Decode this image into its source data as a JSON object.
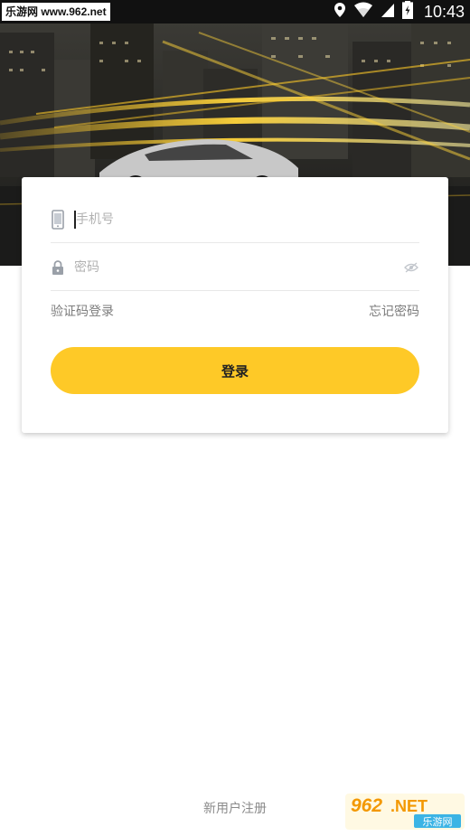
{
  "statusbar": {
    "watermark": "乐游网 www.962.net",
    "time": "10:43",
    "icons": [
      "location-icon",
      "wifi-icon",
      "signal-icon",
      "battery-charging-icon"
    ]
  },
  "login": {
    "phone_placeholder": "手机号",
    "password_placeholder": "密码",
    "sms_login_label": "验证码登录",
    "forgot_password_label": "忘记密码",
    "login_button_label": "登录"
  },
  "footer": {
    "register_label": "新用户注册"
  },
  "watermark_logo": {
    "brand": "962.NET",
    "subtitle": "乐游网"
  },
  "colors": {
    "accent": "#fec927",
    "statusbar": "#111111",
    "placeholder": "#b1b1b1",
    "link": "#7c7c7c"
  }
}
